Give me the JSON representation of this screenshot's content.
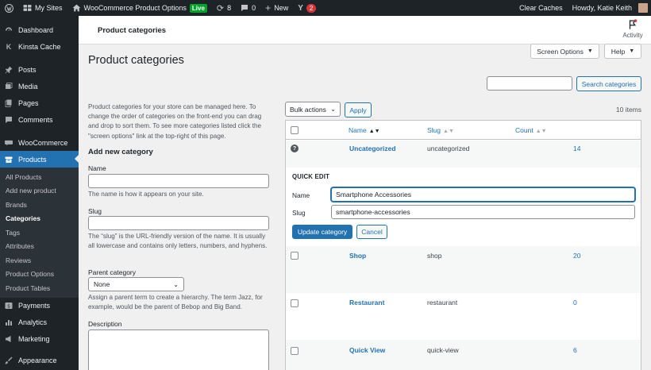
{
  "adminbar": {
    "my_sites": "My Sites",
    "site_name": "WooCommerce Product Options",
    "live_badge": "Live",
    "updates": "8",
    "comments": "0",
    "new": "New",
    "yoast_count": "2",
    "clear_caches": "Clear Caches",
    "howdy": "Howdy, Katie Keith"
  },
  "sidebar": {
    "items": [
      {
        "label": "Dashboard",
        "icon": "dashboard-icon"
      },
      {
        "label": "Kinsta Cache",
        "icon": "kinsta-icon"
      },
      {
        "label": "Posts",
        "icon": "pin-icon"
      },
      {
        "label": "Media",
        "icon": "media-icon"
      },
      {
        "label": "Pages",
        "icon": "pages-icon"
      },
      {
        "label": "Comments",
        "icon": "comment-icon"
      },
      {
        "label": "WooCommerce",
        "icon": "woo-icon"
      },
      {
        "label": "Products",
        "icon": "archive-icon"
      }
    ],
    "submenu": [
      "All Products",
      "Add new product",
      "Brands",
      "Categories",
      "Tags",
      "Attributes",
      "Reviews",
      "Product Options",
      "Product Tables"
    ],
    "bottom": [
      {
        "label": "Payments",
        "icon": "payments-icon"
      },
      {
        "label": "Analytics",
        "icon": "analytics-icon"
      },
      {
        "label": "Marketing",
        "icon": "megaphone-icon"
      },
      {
        "label": "Appearance",
        "icon": "brush-icon"
      }
    ]
  },
  "header": {
    "title": "Product categories",
    "activity": "Activity"
  },
  "page": {
    "title": "Product categories",
    "screen_options": "Screen Options",
    "help": "Help",
    "search_button": "Search categories",
    "intro": "Product categories for your store can be managed here. To change the order of categories on the front-end you can drag and drop to sort them. To see more categories listed click the \"screen options\" link at the top-right of this page."
  },
  "form": {
    "heading": "Add new category",
    "name_label": "Name",
    "name_help": "The name is how it appears on your site.",
    "slug_label": "Slug",
    "slug_help": "The “slug” is the URL-friendly version of the name. It is usually all lowercase and contains only letters, numbers, and hyphens.",
    "parent_label": "Parent category",
    "parent_value": "None",
    "parent_help": "Assign a parent term to create a hierarchy. The term Jazz, for example, would be the parent of Bebop and Big Band.",
    "description_label": "Description"
  },
  "table": {
    "bulk_actions": "Bulk actions",
    "apply": "Apply",
    "count": "10 items",
    "columns": {
      "name": "Name",
      "slug": "Slug",
      "count": "Count"
    },
    "rows": [
      {
        "name": "Uncategorized",
        "slug": "uncategorized",
        "count": "14"
      },
      {
        "name": "Shop",
        "slug": "shop",
        "count": "20"
      },
      {
        "name": "Restaurant",
        "slug": "restaurant",
        "count": "0"
      },
      {
        "name": "Quick View",
        "slug": "quick-view",
        "count": "6"
      }
    ],
    "quick_edit": {
      "title": "QUICK EDIT",
      "name_label": "Name",
      "name_value": "Smartphone Accessories",
      "slug_label": "Slug",
      "slug_value": "smartphone-accessories",
      "update": "Update category",
      "cancel": "Cancel"
    }
  }
}
